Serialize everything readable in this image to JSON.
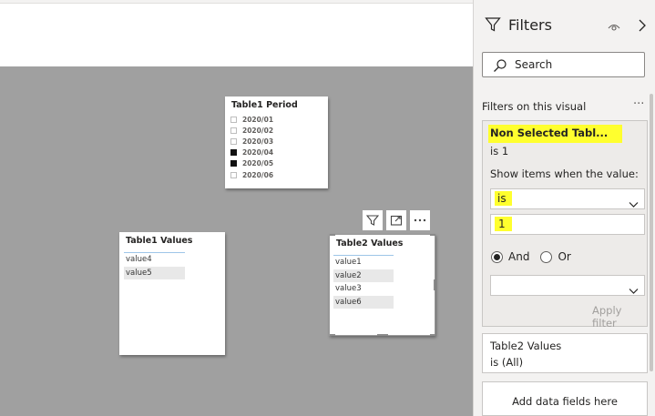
{
  "slicer": {
    "title": "Table1 Period",
    "items": [
      {
        "label": "2020/01",
        "checked": false
      },
      {
        "label": "2020/02",
        "checked": false
      },
      {
        "label": "2020/03",
        "checked": false
      },
      {
        "label": "2020/04",
        "checked": true
      },
      {
        "label": "2020/05",
        "checked": true
      },
      {
        "label": "2020/06",
        "checked": false
      }
    ]
  },
  "table1": {
    "title": "Table1 Values",
    "items": [
      "value4",
      "value5"
    ]
  },
  "table2": {
    "title": "Table2 Values",
    "items": [
      "value1",
      "value2",
      "value3",
      "value6"
    ]
  },
  "filters": {
    "title": "Filters",
    "search_placeholder": "Search",
    "section_label": "Filters on this visual",
    "more": "···",
    "card": {
      "title": "Non Selected Tabl...",
      "summary": "is 1",
      "show_label": "Show items when the value:",
      "operator": "is",
      "value": "1",
      "and_label": "And",
      "or_label": "Or",
      "apply_label": "Apply filter"
    },
    "card2": {
      "title": "Table2 Values",
      "summary": "is (All)"
    },
    "add_fields": "Add data fields here"
  },
  "colors": {
    "highlight": "#ffff2e",
    "canvas": "#a0a0a0",
    "pane": "#f3f2f1"
  }
}
